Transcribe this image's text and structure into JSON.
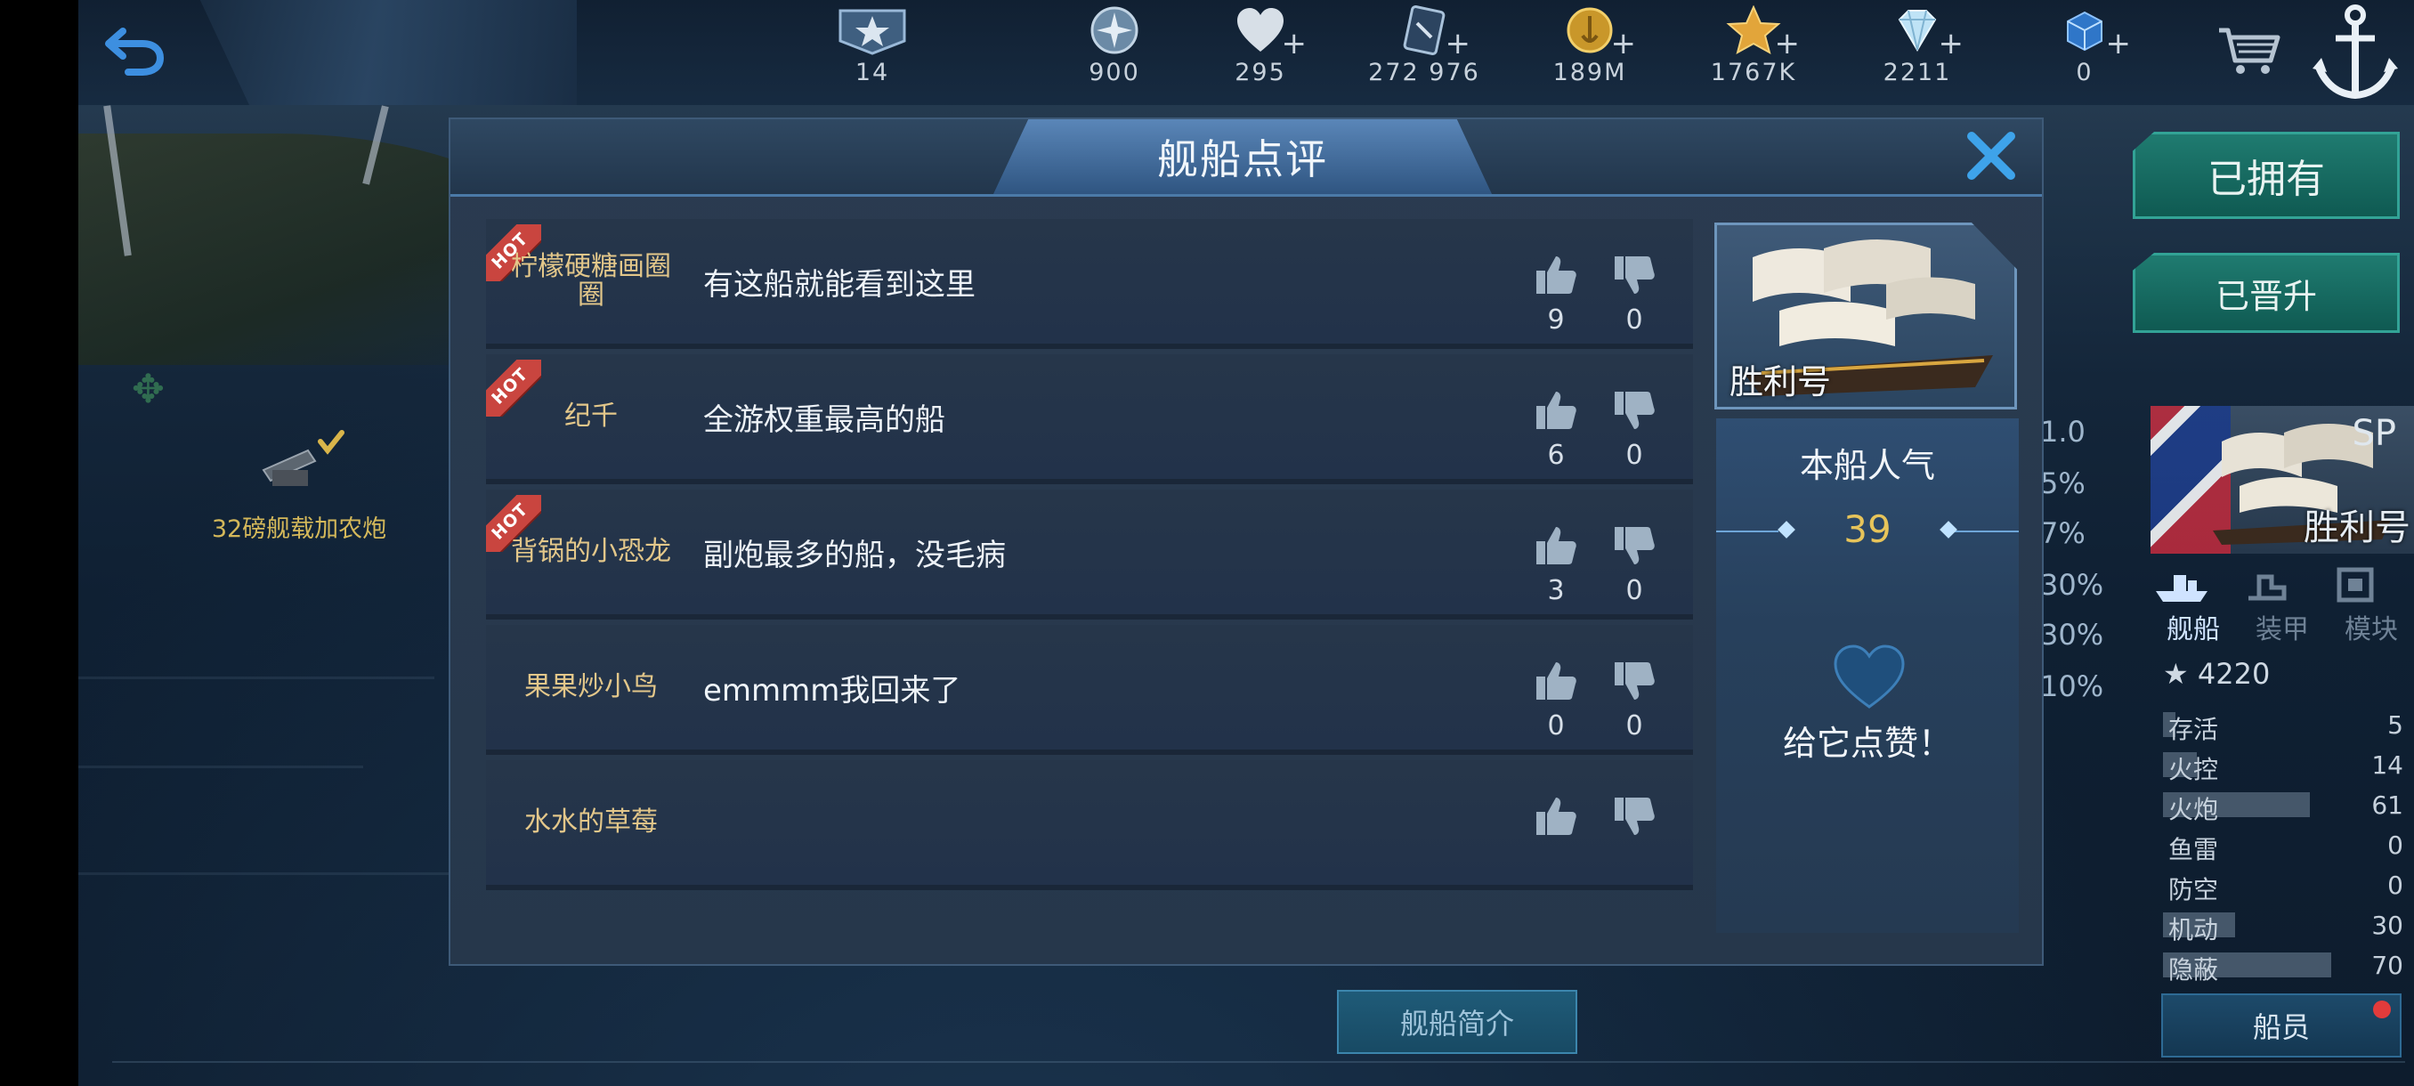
{
  "topbar": {
    "resources": [
      {
        "icon": "rank-star-badge-icon",
        "value": "14",
        "has_plus": false
      },
      {
        "icon": "compass-token-icon",
        "value": "900",
        "has_plus": false
      },
      {
        "icon": "heart-icon",
        "value": "295",
        "has_plus": true
      },
      {
        "icon": "card-icon",
        "value": "272 976",
        "has_plus": true
      },
      {
        "icon": "gold-coin-icon",
        "value": "189M",
        "has_plus": true
      },
      {
        "icon": "gold-star-icon",
        "value": "1767K",
        "has_plus": true
      },
      {
        "icon": "diamond-icon",
        "value": "2211",
        "has_plus": true
      },
      {
        "icon": "blue-box-icon",
        "value": "0",
        "has_plus": true
      }
    ]
  },
  "right_panel": {
    "owned_label": "已拥有",
    "upgraded_label": "已晋升",
    "sp_label": "SP",
    "ship_name": "胜利号",
    "tabs": [
      "舰船",
      "装甲",
      "模块"
    ],
    "score": "4220",
    "stats": [
      {
        "label": "存活",
        "value": "5",
        "fill": 0.05
      },
      {
        "label": "火控",
        "value": "14",
        "fill": 0.14
      },
      {
        "label": "火炮",
        "value": "61",
        "fill": 0.61
      },
      {
        "label": "鱼雷",
        "value": "0",
        "fill": 0
      },
      {
        "label": "防空",
        "value": "0",
        "fill": 0
      },
      {
        "label": "机动",
        "value": "30",
        "fill": 0.3
      },
      {
        "label": "隐蔽",
        "value": "70",
        "fill": 0.7
      }
    ],
    "crew_label": "船员",
    "side_values": [
      "1.0",
      "5%",
      "7%",
      "30%",
      "30%",
      "10%"
    ]
  },
  "scene": {
    "weapon_label": "32磅舰载加农炮"
  },
  "dialog": {
    "title": "舰船点评",
    "hot_label": "HOT",
    "comments": [
      {
        "user": "柠檬硬糖画圈圈",
        "text": "有这船就能看到这里",
        "likes": "9",
        "dislikes": "0",
        "hot": true
      },
      {
        "user": "纪千",
        "text": "全游权重最高的船",
        "likes": "6",
        "dislikes": "0",
        "hot": true
      },
      {
        "user": "背锅的小恐龙",
        "text": "副炮最多的船，没毛病",
        "likes": "3",
        "dislikes": "0",
        "hot": true
      },
      {
        "user": "果果炒小鸟",
        "text": "emmmm我回来了",
        "likes": "0",
        "dislikes": "0",
        "hot": false
      },
      {
        "user": "水水的草莓",
        "text": "",
        "likes": "",
        "dislikes": "",
        "hot": false
      }
    ],
    "ship_name": "胜利号",
    "popularity_label": "本船人气",
    "popularity_value": "39",
    "like_cta": "给它点赞！"
  },
  "bottom": {
    "intro_label": "舰船简介"
  },
  "colors": {
    "accent_gold": "#e7c45a",
    "username": "#e3c78a",
    "hot_red": "#c9453f",
    "teal_button": "#1f7b70"
  }
}
